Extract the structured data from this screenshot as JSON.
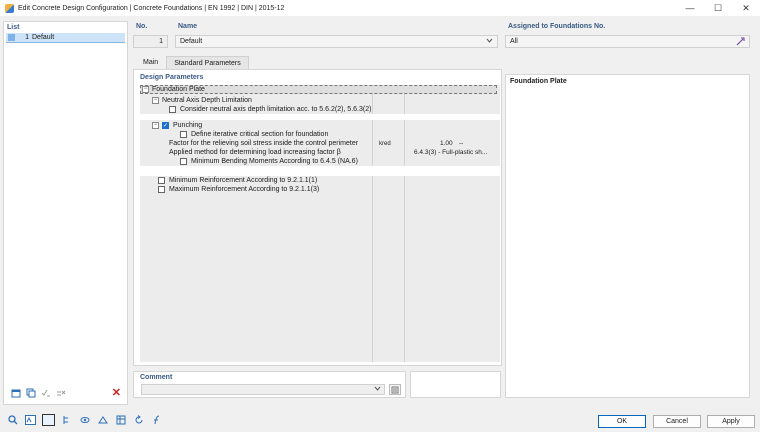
{
  "window": {
    "title": "Edit Concrete Design Configuration | Concrete Foundations | EN 1992 | DIN | 2015-12",
    "minimize_glyph": "—",
    "maximize_glyph": "☐",
    "close_glyph": "✕"
  },
  "list": {
    "header": "List",
    "items": [
      {
        "number": "1",
        "label": "Default",
        "selected": true
      }
    ]
  },
  "fields": {
    "no_label": "No.",
    "no_value": "1",
    "name_label": "Name",
    "name_value": "Default",
    "assigned_label": "Assigned to Foundations No.",
    "assigned_value": "All"
  },
  "tabs": [
    {
      "label": "Main",
      "active": false
    },
    {
      "label": "Standard Parameters",
      "active": true
    }
  ],
  "design_parameters": {
    "header": "Design Parameters",
    "root": "Foundation Plate",
    "neutral_axis": {
      "group": "Neutral Axis Depth Limitation",
      "option": "Consider neutral axis depth limitation acc. to 5.6.2(2), 5.6.3(2)",
      "checked": false
    },
    "punching": {
      "label": "Punching",
      "checked": true,
      "define_iterative": "Define iterative critical section for foundation",
      "relieving_factor_label": "Factor for the relieving soil stress inside the control perimeter",
      "relieving_factor_symbol": "kred",
      "relieving_factor_value": "1.00",
      "relieving_factor_unit": "--",
      "applied_method_label": "Applied method for determining load increasing factor β",
      "applied_method_value": "6.4.3(3) - Full-plastic sh...",
      "min_bending": "Minimum Bending Moments According to 6.4.5 (NA.6)"
    },
    "min_reinforcement": "Minimum Reinforcement According to 9.2.1.1(1)",
    "max_reinforcement": "Maximum Reinforcement According to 9.2.1.1(3)"
  },
  "right_panel": {
    "header": "Foundation Plate"
  },
  "comment": {
    "header": "Comment",
    "value": ""
  },
  "buttons": {
    "ok": "OK",
    "cancel": "Cancel",
    "apply": "Apply"
  },
  "colors": {
    "accent": "#1f6fd1",
    "header_text": "#3a5a85",
    "selection": "#cde3f8",
    "delete": "#d21f1f"
  }
}
